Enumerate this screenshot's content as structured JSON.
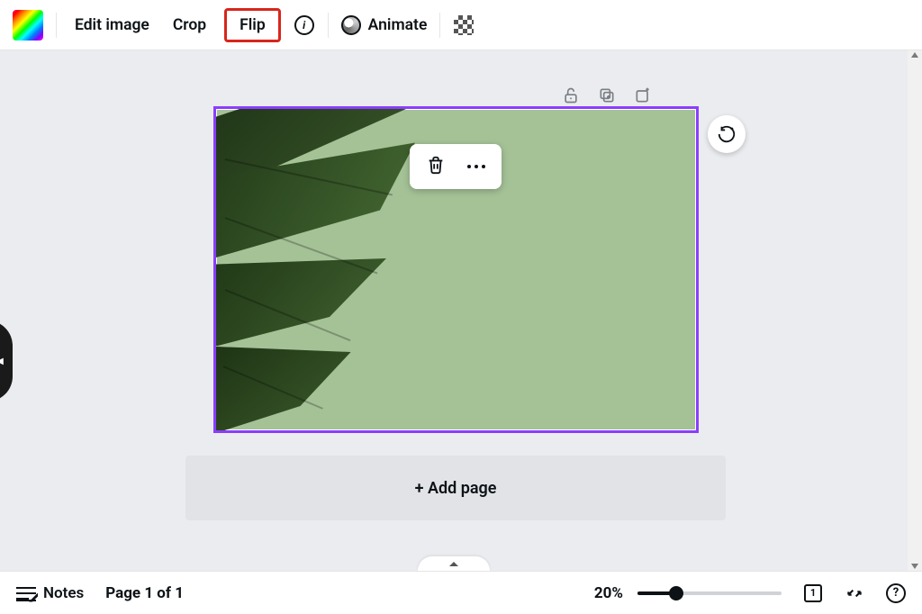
{
  "toolbar": {
    "edit_image": "Edit image",
    "crop": "Crop",
    "flip": "Flip",
    "animate": "Animate"
  },
  "canvas": {
    "add_page": "+ Add page"
  },
  "bottombar": {
    "notes": "Notes",
    "page_info": "Page 1 of 1",
    "zoom_label": "20%",
    "zoom_value": 20,
    "grid_count": "1",
    "help": "?"
  },
  "annotation": {
    "target": "flip-button"
  }
}
